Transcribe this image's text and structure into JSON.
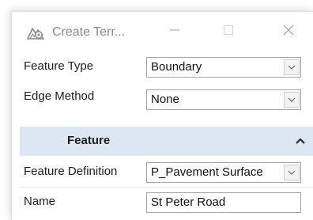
{
  "window": {
    "title": "Create Terr..."
  },
  "fields": {
    "feature_type": {
      "label": "Feature Type",
      "value": "Boundary"
    },
    "edge_method": {
      "label": "Edge Method",
      "value": "None"
    }
  },
  "feature_section": {
    "title": "Feature",
    "expanded": true,
    "feature_definition": {
      "label": "Feature Definition",
      "value": "P_Pavement Surface"
    },
    "name": {
      "label": "Name",
      "value": "St Peter Road"
    }
  },
  "icons": {
    "app": "terrain-model-icon",
    "minimize": "minimize-icon",
    "maximize": "maximize-icon",
    "close": "close-icon",
    "dropdown": "chevron-down-icon",
    "collapse": "chevron-up-icon"
  },
  "colors": {
    "section_header_bg": "#dde7f4",
    "title_text": "#8a8a8a"
  }
}
